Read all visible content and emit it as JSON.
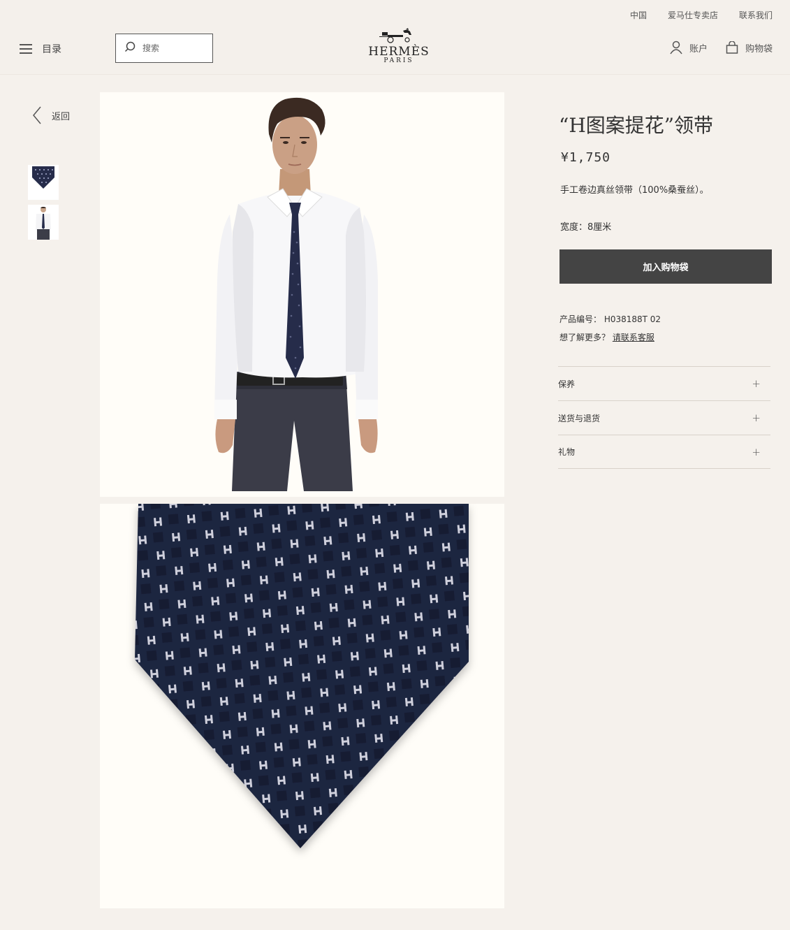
{
  "header": {
    "top_links": [
      "中国",
      "爱马仕专卖店",
      "联系我们"
    ],
    "menu_label": "目录",
    "search_placeholder": "搜索",
    "logo_text": "HERMÈS",
    "logo_sub": "PARIS",
    "account_label": "账户",
    "bag_label": "购物袋"
  },
  "sidebar": {
    "back_label": "返回",
    "thumbnails": [
      "tie-detail-thumbnail",
      "model-thumbnail"
    ]
  },
  "product": {
    "title": "“H图案提花”领带",
    "price": "¥1,750",
    "description": "手工卷边真丝领带（100%桑蚕丝）。",
    "width_label": "宽度：8厘米",
    "add_to_bag": "加入购物袋",
    "sku_label": "产品编号： H038188T 02",
    "more_prefix": "想了解更多？",
    "more_link": "请联系客服",
    "accordion": [
      "保养",
      "送货与退货",
      "礼物"
    ]
  },
  "colors": {
    "background": "#f5f1ec",
    "button": "#444444",
    "tie_navy": "#1f2540"
  }
}
